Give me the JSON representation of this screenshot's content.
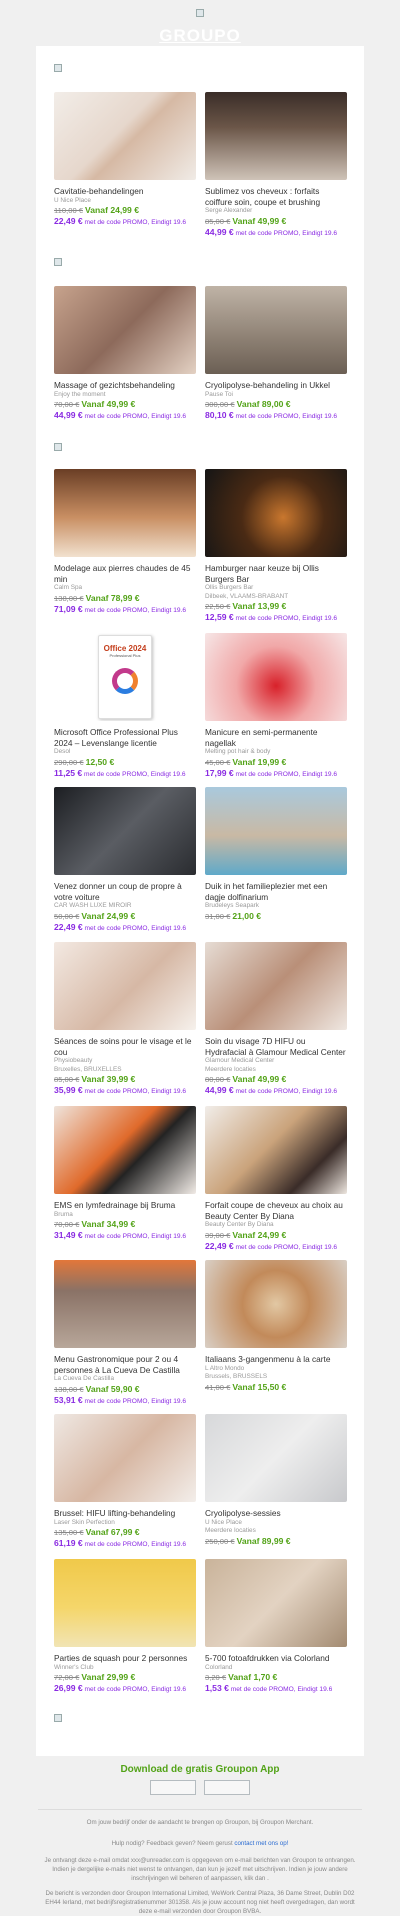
{
  "header": {
    "logo": "GROUPO"
  },
  "deals": [
    {
      "title": "Cavitatie-behandelingen",
      "merchant": "U Nice Place",
      "location": "",
      "old": "110,00 €",
      "price": "Vanaf 24,99 €",
      "promo": "22,49 €",
      "promo_text": "met de code PROMO, Eindigt 19.6"
    },
    {
      "title": "Sublimez vos cheveux : forfaits coiffure soin, coupe et brushing",
      "merchant": "Serge Alexander",
      "location": "",
      "old": "85,00 €",
      "price": "Vanaf 49,99 €",
      "promo": "44,99 €",
      "promo_text": "met de code PROMO, Eindigt 19.6"
    },
    {
      "title": "Massage of gezichtsbehandeling",
      "merchant": "Enjoy the moment",
      "location": "",
      "old": "70,00 €",
      "price": "Vanaf 49,99 €",
      "promo": "44,99 €",
      "promo_text": "met de code PROMO, Eindigt 19.6"
    },
    {
      "title": "Cryolipolyse-behandeling in Ukkel",
      "merchant": "Pause Toi",
      "location": "",
      "old": "300,00 €",
      "price": "Vanaf 89,00 €",
      "promo": "80,10 €",
      "promo_text": "met de code PROMO, Eindigt 19.6"
    },
    {
      "title": "Modelage aux pierres chaudes de 45 min",
      "merchant": "Calm Spa",
      "location": "",
      "old": "138,00 €",
      "price": "Vanaf 78,99 €",
      "promo": "71,09 €",
      "promo_text": "met de code PROMO, Eindigt 19.6"
    },
    {
      "title": "Hamburger naar keuze bij Ollis Burgers Bar",
      "merchant": "Ollis Burgers Bar",
      "location": "Dilbeek, VLAAMS-BRABANT",
      "old": "22,50 €",
      "price": "Vanaf 13,99 €",
      "promo": "12,59 €",
      "promo_text": "met de code PROMO, Eindigt 19.6"
    },
    {
      "title": "Microsoft Office Professional Plus 2024 – Levenslange licentie",
      "merchant": "Desol",
      "location": "",
      "old": "290,00 €",
      "price": "12,50 €",
      "promo": "11,25 €",
      "promo_text": "met de code PROMO, Eindigt 19.6"
    },
    {
      "title": "Manicure en semi-permanente nagellak",
      "merchant": "Melting pot hair & body",
      "location": "",
      "old": "45,00 €",
      "price": "Vanaf 19,99 €",
      "promo": "17,99 €",
      "promo_text": "met de code PROMO, Eindigt 19.6"
    },
    {
      "title": "Venez donner un coup de propre à votre voiture",
      "merchant": "CAR WASH LUXE MIROIR",
      "location": "",
      "old": "50,00 €",
      "price": "Vanaf 24,99 €",
      "promo": "22,49 €",
      "promo_text": "met de code PROMO, Eindigt 19.6"
    },
    {
      "title": "Duik in het familieplezier met een dagje dolfinarium",
      "merchant": "Brudeleys Seapark",
      "location": "",
      "old": "31,00 €",
      "price": "21,00 €",
      "promo": "",
      "promo_text": ""
    },
    {
      "title": "Séances de soins pour le visage et le cou",
      "merchant": "Physiobeauty",
      "location": "Bruxelles, BRUXELLES",
      "old": "85,00 €",
      "price": "Vanaf 39,99 €",
      "promo": "35,99 €",
      "promo_text": "met de code PROMO, Eindigt 19.6"
    },
    {
      "title": "Soin du visage 7D HIFU ou Hydrafacial à Glamour Medical Center",
      "merchant": "Glamour Medical Center",
      "location": "Meerdere locaties",
      "old": "80,00 €",
      "price": "Vanaf 49,99 €",
      "promo": "44,99 €",
      "promo_text": "met de code PROMO, Eindigt 19.6"
    },
    {
      "title": "EMS en lymfedrainage bij Bruma",
      "merchant": "Bruma",
      "location": "",
      "old": "70,00 €",
      "price": "Vanaf 34,99 €",
      "promo": "31,49 €",
      "promo_text": "met de code PROMO, Eindigt 19.6"
    },
    {
      "title": "Forfait coupe de cheveux au choix au Beauty Center By Diana",
      "merchant": "Beauty Center By Diana",
      "location": "",
      "old": "39,00 €",
      "price": "Vanaf 24,99 €",
      "promo": "22,49 €",
      "promo_text": "met de code PROMO, Eindigt 19.6"
    },
    {
      "title": "Menu Gastronomique pour 2 ou 4 personnes à La Cueva De Castilla",
      "merchant": "La Cueva De Castilla",
      "location": "",
      "old": "138,00 €",
      "price": "Vanaf 59,90 €",
      "promo": "53,91 €",
      "promo_text": "met de code PROMO, Eindigt 19.6"
    },
    {
      "title": "Italiaans 3-gangenmenu à la carte",
      "merchant": "L Altro Mondo",
      "location": "Brussels, BRUSSELS",
      "old": "41,00 €",
      "price": "Vanaf 15,50 €",
      "promo": "",
      "promo_text": ""
    },
    {
      "title": "Brussel: HIFU lifting-behandeling",
      "merchant": "Laser Skin Perfection",
      "location": "",
      "old": "135,00 €",
      "price": "Vanaf 67,99 €",
      "promo": "61,19 €",
      "promo_text": "met de code PROMO, Eindigt 19.6"
    },
    {
      "title": "Cryolipolyse-sessies",
      "merchant": "U Nice Place",
      "location": "Meerdere locaties",
      "old": "250,00 €",
      "price": "Vanaf 89,99 €",
      "promo": "",
      "promo_text": ""
    },
    {
      "title": "Parties de squash pour 2 personnes",
      "merchant": "Winner's Club",
      "location": "",
      "old": "72,00 €",
      "price": "Vanaf 29,99 €",
      "promo": "26,99 €",
      "promo_text": "met de code PROMO, Eindigt 19.6"
    },
    {
      "title": "5-700 fotoafdrukken via Colorland",
      "merchant": "Colorland",
      "location": "",
      "old": "3,20 €",
      "price": "Vanaf 1,70 €",
      "promo": "1,53 €",
      "promo_text": "met de code PROMO, Eindigt 19.6"
    }
  ],
  "footer": {
    "app_title": "Download de gratis Groupon App",
    "merchant_line": "Om jouw bedrijf onder de aandacht te brengen op Groupon, bij Groupon Merchant.",
    "help_prefix": "Hulp nodig? Feedback geven? Neem gerust ",
    "help_link": "contact met ons op!",
    "unsub": "Je ontvangt deze e-mail omdat xxx@unreader.com is opgegeven om e-mail berichten van Groupon te ontvangen. Indien je dergelijke e-mails niet wenst te ontvangen, dan kun je jezelf met uitschrijven. Indien je jouw andere inschrijvingen wil beheren of aanpassen, klik dan .",
    "legal": "De bericht is verzonden door Groupon International Limited, WeWork Central Plaza, 36 Dame Street, Dublin D02 EH44 Ierland, met bedrijfsregistratienummer 301358. Als je jouw account nog niet heeft overgedragen, dan wordt deze e-mail verzonden door Groupon BVBA."
  }
}
